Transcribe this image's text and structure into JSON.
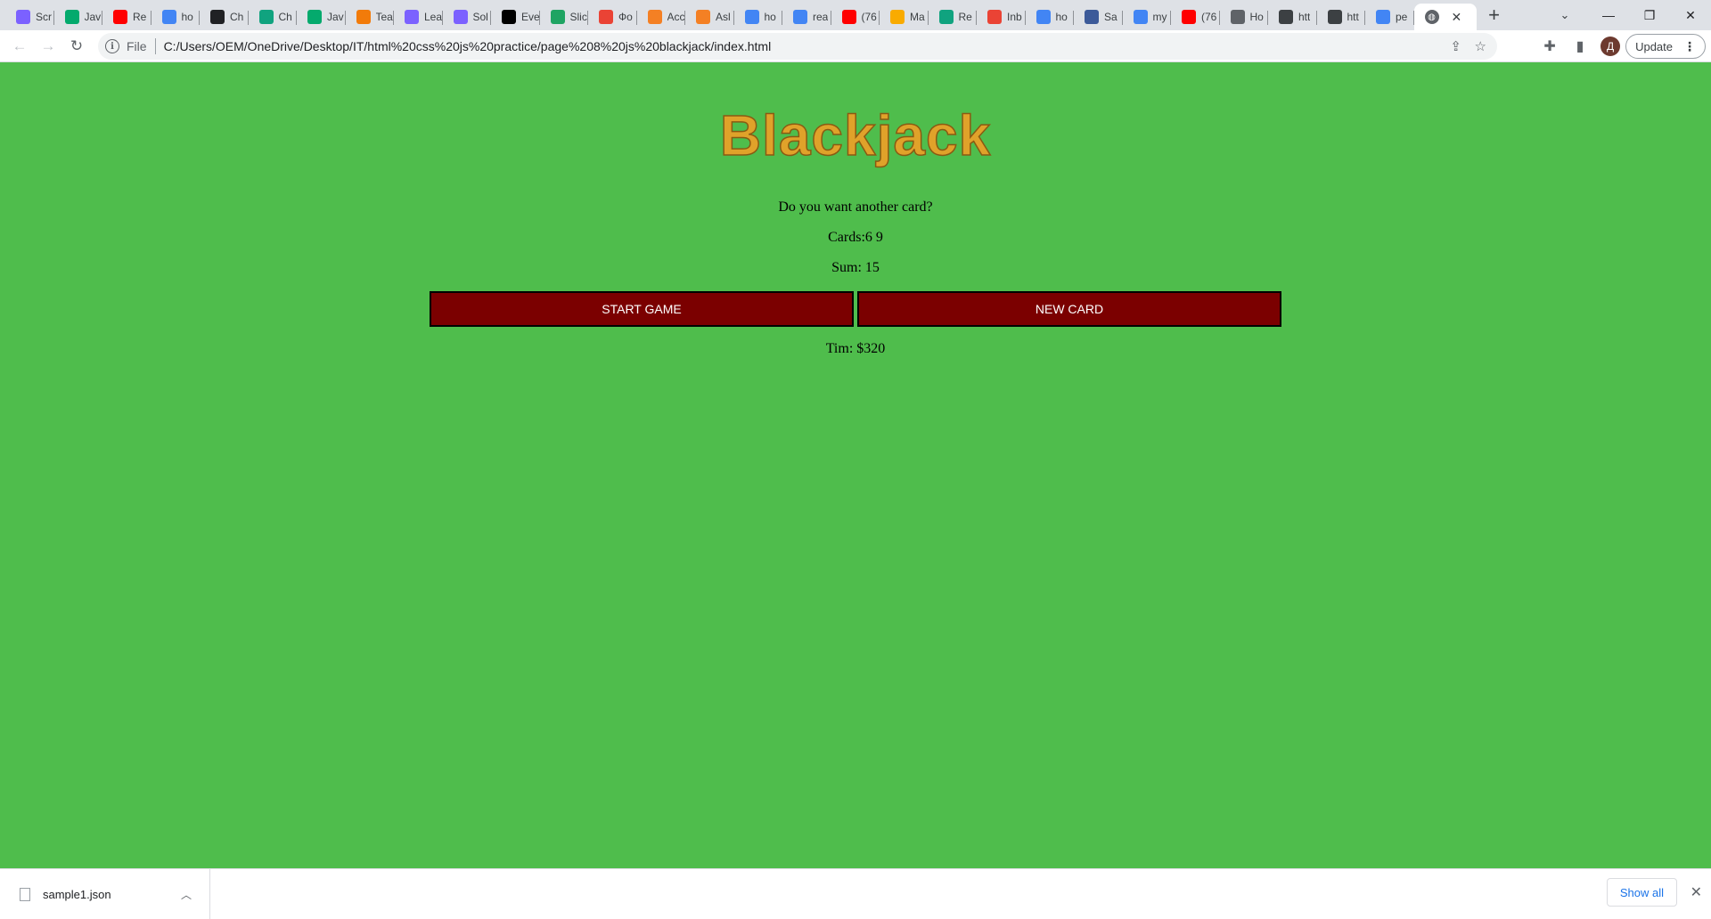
{
  "browser": {
    "tabs": [
      {
        "title": "Scr",
        "icon": "line-icon",
        "color": "#7b61ff"
      },
      {
        "title": "Jav",
        "icon": "w3schools-icon",
        "color": "#04aa6d"
      },
      {
        "title": "Re",
        "icon": "youtube-icon",
        "color": "#ff0000"
      },
      {
        "title": "ho",
        "icon": "google-icon",
        "color": "#4285f4"
      },
      {
        "title": "Ch",
        "icon": "openai-icon",
        "color": "#202124"
      },
      {
        "title": "Ch",
        "icon": "openai-icon",
        "color": "#10a37f"
      },
      {
        "title": "Jav",
        "icon": "w3schools-icon",
        "color": "#04aa6d"
      },
      {
        "title": "Tea",
        "icon": "scrimba-icon",
        "color": "#f27b0a"
      },
      {
        "title": "Lea",
        "icon": "line-icon",
        "color": "#7b61ff"
      },
      {
        "title": "Sol",
        "icon": "line-icon",
        "color": "#7b61ff"
      },
      {
        "title": "Eve",
        "icon": "medium-icon",
        "color": "#000000"
      },
      {
        "title": "Slic",
        "icon": "drive-icon",
        "color": "#1fa463"
      },
      {
        "title": "Фо",
        "icon": "photos-icon",
        "color": "#ea4335"
      },
      {
        "title": "Acc",
        "icon": "stackoverflow-icon",
        "color": "#f48024"
      },
      {
        "title": "Asl",
        "icon": "stackoverflow-icon",
        "color": "#f48024"
      },
      {
        "title": "ho",
        "icon": "google-icon",
        "color": "#4285f4"
      },
      {
        "title": "rea",
        "icon": "google-icon",
        "color": "#4285f4"
      },
      {
        "title": "(76",
        "icon": "youtube-icon",
        "color": "#ff0000"
      },
      {
        "title": "Ma",
        "icon": "bolt-icon",
        "color": "#f9ab00"
      },
      {
        "title": "Re",
        "icon": "openai-icon",
        "color": "#10a37f"
      },
      {
        "title": "Inb",
        "icon": "gmail-icon",
        "color": "#ea4335"
      },
      {
        "title": "ho",
        "icon": "google-icon",
        "color": "#4285f4"
      },
      {
        "title": "Sa",
        "icon": "badge-icon",
        "color": "#3c5a99"
      },
      {
        "title": "my",
        "icon": "google-icon",
        "color": "#4285f4"
      },
      {
        "title": "(76",
        "icon": "youtube-icon",
        "color": "#ff0000"
      },
      {
        "title": "Ho",
        "icon": "leaf-icon",
        "color": "#5f6368"
      },
      {
        "title": "htt",
        "icon": "robot-icon",
        "color": "#3c4043"
      },
      {
        "title": "htt",
        "icon": "robot-icon",
        "color": "#3c4043"
      },
      {
        "title": "pe",
        "icon": "google-icon",
        "color": "#4285f4"
      }
    ],
    "active_tab_icon": "globe-icon",
    "address": {
      "scheme_label": "File",
      "url": "C:/Users/OEM/OneDrive/Desktop/IT/html%20css%20js%20practice/page%208%20js%20blackjack/index.html"
    },
    "profile_initial": "Д",
    "update_label": "Update"
  },
  "game": {
    "title": "Blackjack",
    "message": "Do you want another card?",
    "cards": "Cards:6 9",
    "sum": "Sum: 15",
    "start_button": "START GAME",
    "new_card_button": "NEW CARD",
    "player": "Tim: $320"
  },
  "downloads": {
    "file_name": "sample1.json",
    "show_all": "Show all"
  },
  "colors": {
    "page_background": "#4fbd4c",
    "title": "#e0a22a",
    "button": "#7b0000"
  }
}
